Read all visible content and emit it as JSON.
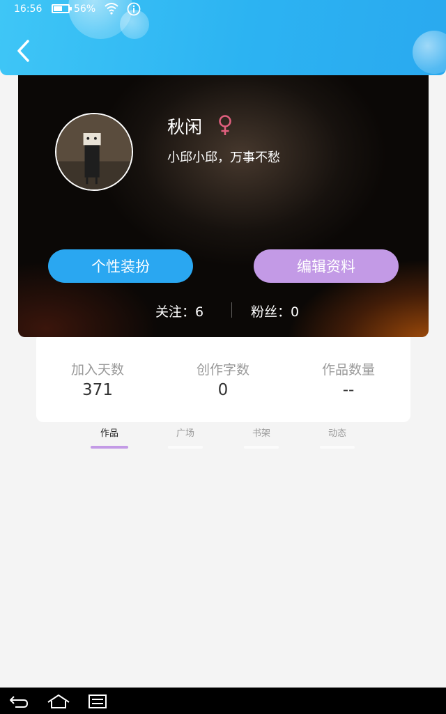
{
  "status_bar": {
    "time": "16:56",
    "battery": "56%",
    "battery_level": 0.56,
    "icons": [
      "battery-icon",
      "wifi-icon",
      "info-icon"
    ]
  },
  "header": {
    "back_icon": "chevron-left-icon"
  },
  "profile": {
    "nickname": "秋闲",
    "gender_icon": "female-icon",
    "bio": "小邱小邱，万事不愁",
    "dress_button": "个性装扮",
    "edit_button": "编辑资料",
    "following": "关注：6",
    "fans": "粉丝：0"
  },
  "stats": [
    {
      "label": "加入天数",
      "value": "371"
    },
    {
      "label": "创作字数",
      "value": "0"
    },
    {
      "label": "作品数量",
      "value": "--"
    }
  ],
  "tabs": [
    {
      "label": "作品",
      "active": true
    },
    {
      "label": "广场",
      "active": false
    },
    {
      "label": "书架",
      "active": false
    },
    {
      "label": "动态",
      "active": false
    }
  ],
  "navbar": {
    "icons": [
      "back-icon",
      "home-icon",
      "recent-apps-icon"
    ]
  },
  "colors": {
    "header_blue": "#2cb3f2",
    "dress_button": "#2aa7f1",
    "edit_button": "#c39ae6",
    "gender_pink": "#e2607f",
    "tab_indicator": "#c39ae6"
  }
}
